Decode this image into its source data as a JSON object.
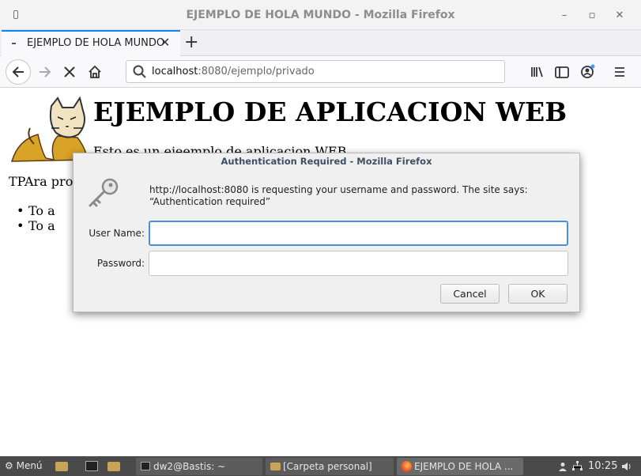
{
  "window": {
    "title": "EJEMPLO DE HOLA MUNDO - Mozilla Firefox",
    "minimize_label": "–",
    "maximize_label": "▫",
    "close_label": "✕"
  },
  "tabs": [
    {
      "label": "EJEMPLO DE HOLA MUNDO",
      "close": "✕"
    }
  ],
  "new_tab_label": "+",
  "url": {
    "host": "localhost",
    "path": ":8080/ejemplo/privado"
  },
  "page": {
    "heading": "EJEMPLO DE APLICACION WEB",
    "subtitle": "Esto es un ejeemplo de aplicacion WEB",
    "paragraph": "TPAra pro",
    "bullets": [
      "To a",
      "To a"
    ]
  },
  "dialog": {
    "title": "Authentication Required - Mozilla Firefox",
    "message": "http://localhost:8080 is requesting your username and password. The site says: “Authentication required”",
    "username_label": "User Name:",
    "username_value": "",
    "password_label": "Password:",
    "password_value": "",
    "cancel_label": "Cancel",
    "ok_label": "OK"
  },
  "taskbar": {
    "menu_label": "Menú",
    "tasks": [
      {
        "label": "dw2@Bastis: ~"
      },
      {
        "label": "[Carpeta personal]"
      },
      {
        "label": "EJEMPLO DE HOLA ..."
      }
    ],
    "clock": "10:25"
  },
  "colors": {
    "tab_accent": "#0a84ff",
    "focus_border": "#4a90d9",
    "taskbar_bg": "#4a4a4a"
  }
}
